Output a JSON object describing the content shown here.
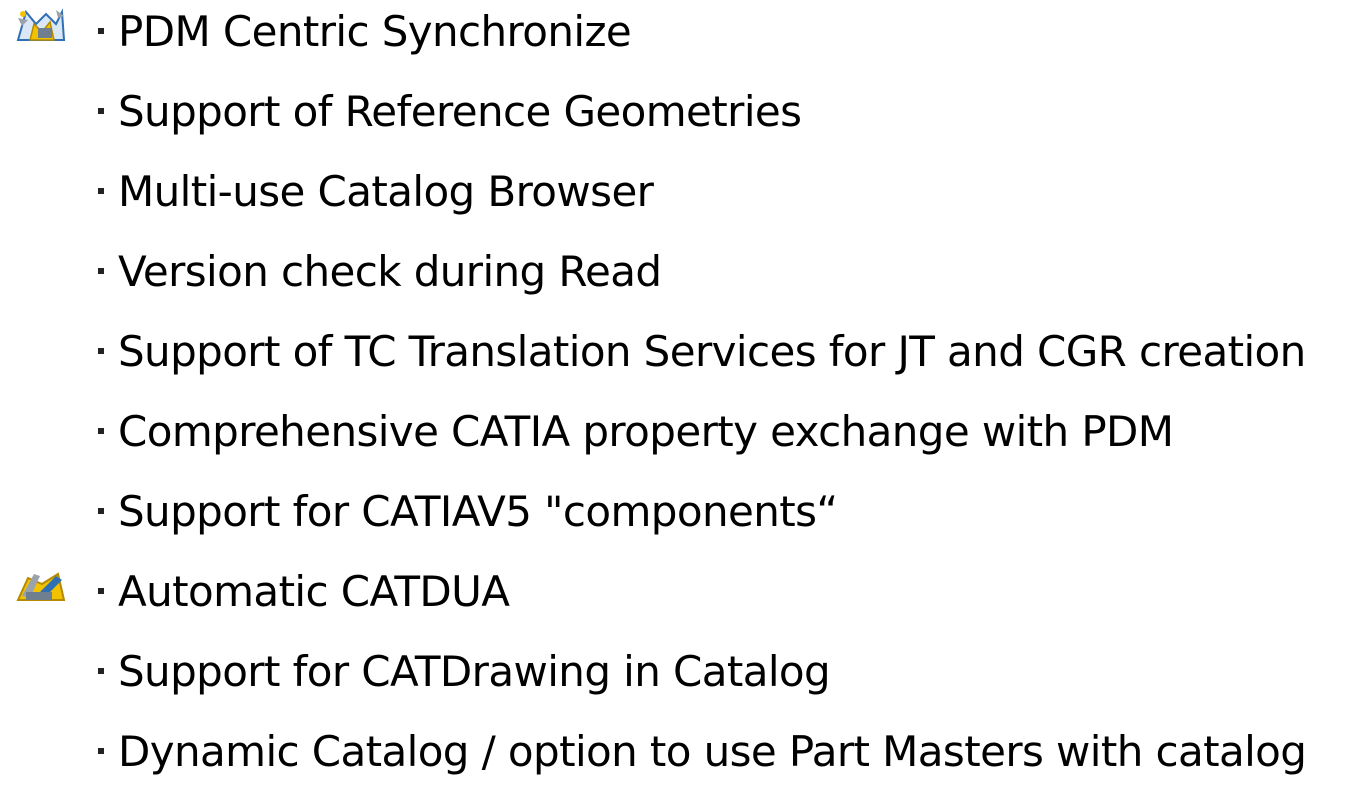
{
  "items": [
    {
      "text": "PDM Centric Synchronize",
      "icon": "synchronize-icon"
    },
    {
      "text": "Support of Reference Geometries"
    },
    {
      "text": "Multi-use Catalog Browser"
    },
    {
      "text": "Version check during Read"
    },
    {
      "text": "Support of TC Translation Services for JT and CGR creation"
    },
    {
      "text": "Comprehensive CATIA property exchange with PDM"
    },
    {
      "text": "Support for CATIAV5 \"components“"
    },
    {
      "text": "Automatic CATDUA",
      "icon": "catdua-tools-icon"
    },
    {
      "text": "Support for CATDrawing in Catalog"
    },
    {
      "text": "Dynamic Catalog / option to use Part Masters with catalog"
    }
  ],
  "colors": {
    "text": "#000000",
    "bullet": "#222222",
    "icon_yellow": "#f2c200",
    "icon_blue": "#2f6fb3",
    "icon_gray": "#9aa3ad"
  }
}
